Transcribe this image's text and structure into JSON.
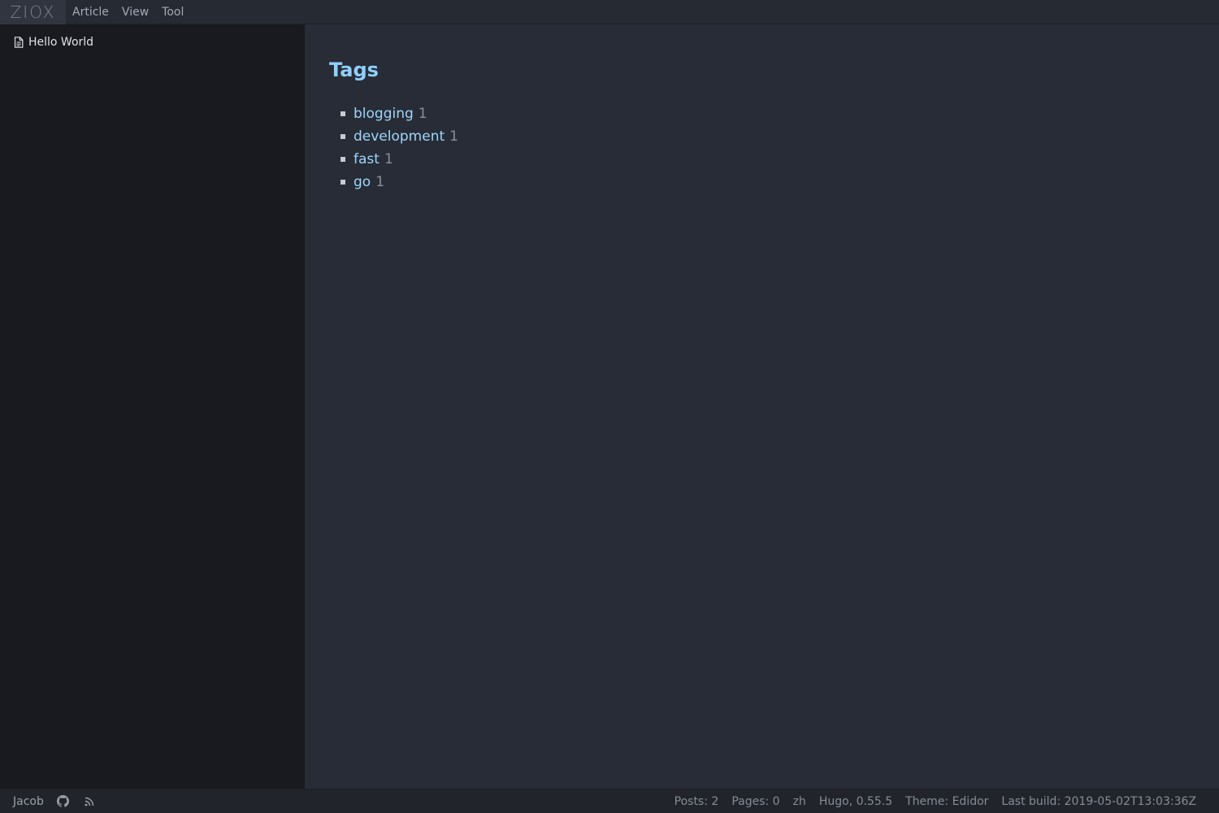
{
  "menubar": {
    "logo": "ZIOX",
    "items": [
      "Article",
      "View",
      "Tool"
    ]
  },
  "sidebar": {
    "files": [
      {
        "label": "Hello World",
        "icon": "file-icon"
      }
    ]
  },
  "main": {
    "title": "Tags",
    "tags": [
      {
        "name": "blogging",
        "count": "1"
      },
      {
        "name": "development",
        "count": "1"
      },
      {
        "name": "fast",
        "count": "1"
      },
      {
        "name": "go",
        "count": "1"
      }
    ]
  },
  "statusbar": {
    "author": "Jacob",
    "posts": "Posts: 2",
    "pages": "Pages: 0",
    "lang": "zh",
    "hugo": "Hugo, 0.55.5",
    "theme": "Theme: Edidor",
    "last_build": "Last build: 2019-05-02T13:03:36Z"
  },
  "colors": {
    "accent": "#8fd0ff",
    "tag_link": "#9ed5fb",
    "sidebar_bg": "#181a1f",
    "main_bg": "#282c36"
  }
}
